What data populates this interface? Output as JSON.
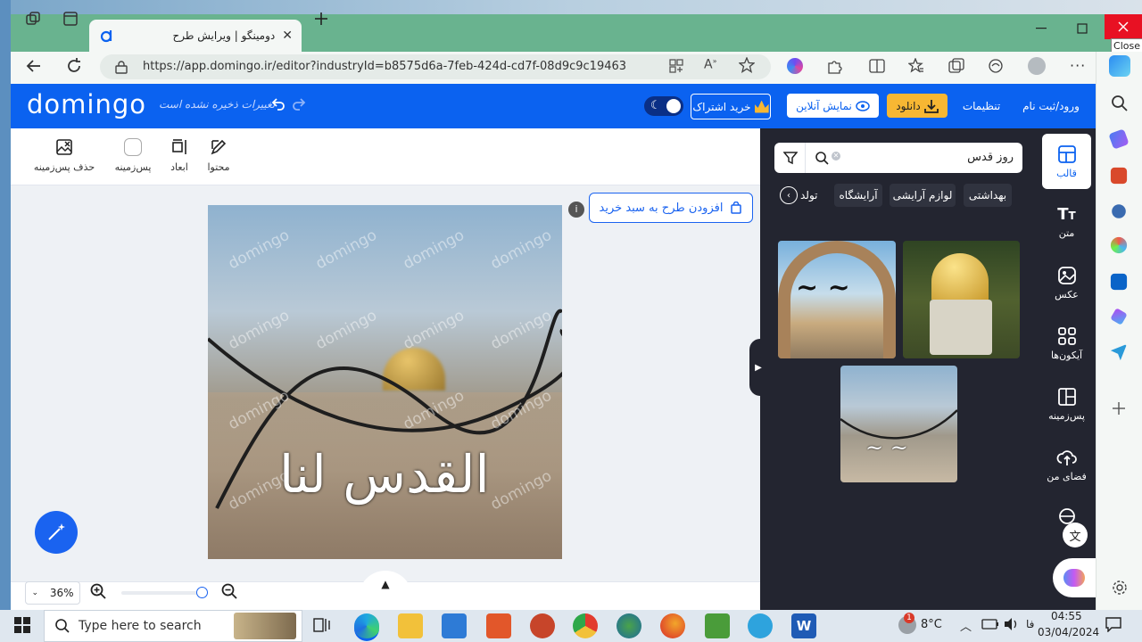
{
  "browser": {
    "tab_title": "دومینگو | ویرایش طرح",
    "url": "https://app.domingo.ir/editor?industryId=b8575d6a-7feb-424d-cd7f-08d9c9c19463",
    "close_tooltip": "Close"
  },
  "header": {
    "logo": "domingo",
    "unsaved_text": "تغییرات ذخیره نشده است",
    "login_label": "ورود/ثبت نام",
    "settings_label": "تنظیمات",
    "download_label": "دانلود",
    "preview_label": "نمایش آنلاین",
    "subscribe_label": "خرید اشتراک"
  },
  "toolbar": {
    "content_label": "محتوا",
    "dimensions_label": "ابعاد",
    "background_label": "پس‌زمینه",
    "remove_bg_label": "حذف پس‌زمینه"
  },
  "canvas": {
    "add_to_cart_label": "افزودن طرح به سبد خرید",
    "watermark": "domingo",
    "calligraphy": "القدس لنا",
    "zoom_value": "36%"
  },
  "panel": {
    "search_value": "روز قدس",
    "chips": [
      "بهداشتی",
      "لوازم آرایشی",
      "آرایشگاه",
      "تولد"
    ]
  },
  "rail": {
    "items": [
      {
        "label": "قالب",
        "icon": "template-icon"
      },
      {
        "label": "متن",
        "icon": "text-icon"
      },
      {
        "label": "عکس",
        "icon": "image-icon"
      },
      {
        "label": "آیکون‌ها",
        "icon": "grid-icon"
      },
      {
        "label": "پس‌زمینه",
        "icon": "background-icon"
      },
      {
        "label": "فضای من",
        "icon": "cloud-upload-icon"
      }
    ]
  },
  "taskbar": {
    "search_placeholder": "Type here to search",
    "temperature": "8°C",
    "language": "فا",
    "time": "04:55",
    "date": "03/04/2024"
  }
}
